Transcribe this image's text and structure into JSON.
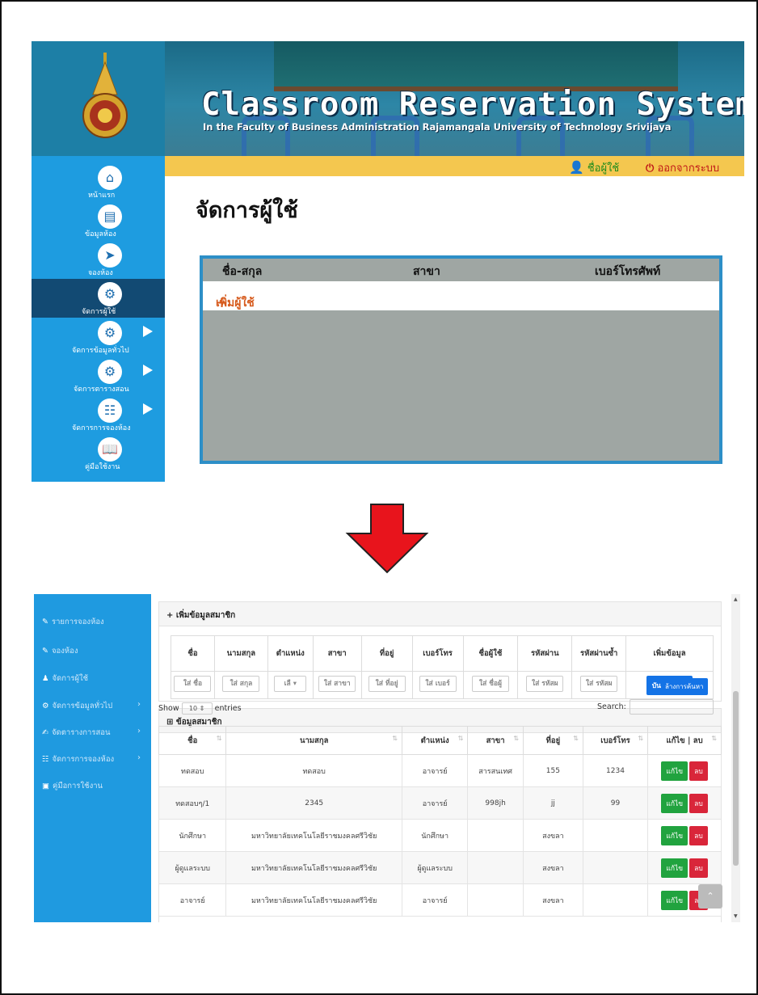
{
  "top": {
    "banner_title": "Classroom Reservation System",
    "banner_subtitle": "In the Faculty of Business Administration Rajamangala University of Technology Srivijaya",
    "user_link": "ชื่อผู้ใช้",
    "logout_link": "ออกจากระบบ",
    "nav": [
      {
        "label": "หน้าแรก",
        "icon": "home-icon"
      },
      {
        "label": "ข้อมูลห้อง",
        "icon": "document-icon"
      },
      {
        "label": "จองห้อง",
        "icon": "cursor-icon"
      },
      {
        "label": "จัดการผู้ใช้",
        "icon": "user-gear-icon"
      },
      {
        "label": "จัดการข้อมูลทั่วไป",
        "icon": "chart-gear-icon"
      },
      {
        "label": "จัดการตารางสอน",
        "icon": "table-gear-icon"
      },
      {
        "label": "จัดการการจองห้อง",
        "icon": "sitemap-icon"
      },
      {
        "label": "คู่มือใช้งาน",
        "icon": "book-icon"
      }
    ],
    "page_title": "จัดการผู้ใช้",
    "table_headers": [
      "ชื่อ-สกุล",
      "สาขา",
      "เบอร์โทรศัพท์"
    ],
    "add_user": "เพิ่มผู้ใช้"
  },
  "colors": {
    "accent_blue": "#1e9ce0",
    "active_nav": "#124a73",
    "arrow_red": "#e8141c",
    "userbar": "#f4c74f"
  },
  "bottom": {
    "nav": [
      {
        "label": "รายการจองห้อง",
        "icon": "pencil-icon"
      },
      {
        "label": "จองห้อง",
        "icon": "pencil-icon"
      },
      {
        "label": "จัดการผู้ใช้",
        "icon": "user-icon"
      },
      {
        "label": "จัดการข้อมูลทั่วไป",
        "icon": "cogs-icon"
      },
      {
        "label": "จัดตารางการสอน",
        "icon": "edit-icon"
      },
      {
        "label": "จัดการการจองห้อง",
        "icon": "sitemap-icon"
      },
      {
        "label": "คู่มือการใช้งาน",
        "icon": "file-icon"
      }
    ],
    "add_card_title": "+ เพิ่มข้อมูลสมาชิก",
    "form_headers": [
      "ชื่อ",
      "นามสกุล",
      "ตำแหน่ง",
      "สาขา",
      "ที่อยู่",
      "เบอร์โทร",
      "ชื่อผู้ใช้",
      "รหัสผ่าน",
      "รหัสผ่านซ้ำ",
      "เพิ่มข้อมูล"
    ],
    "form_placeholders": [
      "ใส่ ชื่อ",
      "ใส่ สกุล",
      "เลื",
      "ใส่ สาขา",
      "ใส่ ที่อยู่",
      "ใส่ เบอร์",
      "ใส่ ชื่อผู้",
      "ใส่ รหัสผ",
      "ใส่ รหัสผ"
    ],
    "save_button": "บันทึกข้อมูล",
    "list_card_title": "ข้อมูลสมาชิก",
    "clear_search": "ล้างการค้นหา",
    "show_label": "Show",
    "show_value": "10",
    "entries_label": "entries",
    "search_label": "Search:",
    "columns": [
      "ชื่อ",
      "นามสกุล",
      "ตำแหน่ง",
      "สาขา",
      "ที่อยู่",
      "เบอร์โทร",
      "แก้ไข | ลบ"
    ],
    "rows": [
      [
        "ทดสอบ",
        "ทดสอบ",
        "อาจารย์",
        "สารสนเทศ",
        "155",
        "1234"
      ],
      [
        "ทดสอบๆ/1",
        "2345",
        "อาจารย์",
        "998jh",
        "jj",
        "99"
      ],
      [
        "นักศึกษา",
        "มหาวิทยาลัยเทคโนโลยีราชมงคลศรีวิชัย",
        "นักศึกษา",
        "",
        "สงขลา",
        ""
      ],
      [
        "ผู้ดูแลระบบ",
        "มหาวิทยาลัยเทคโนโลยีราชมงคลศรีวิชัย",
        "ผู้ดูแลระบบ",
        "",
        "สงขลา",
        ""
      ],
      [
        "อาจารย์",
        "มหาวิทยาลัยเทคโนโลยีราชมงคลศรีวิชัย",
        "อาจารย์",
        "",
        "สงขลา",
        ""
      ]
    ],
    "edit_button": "แก้ไข",
    "delete_button": "ลบ"
  }
}
